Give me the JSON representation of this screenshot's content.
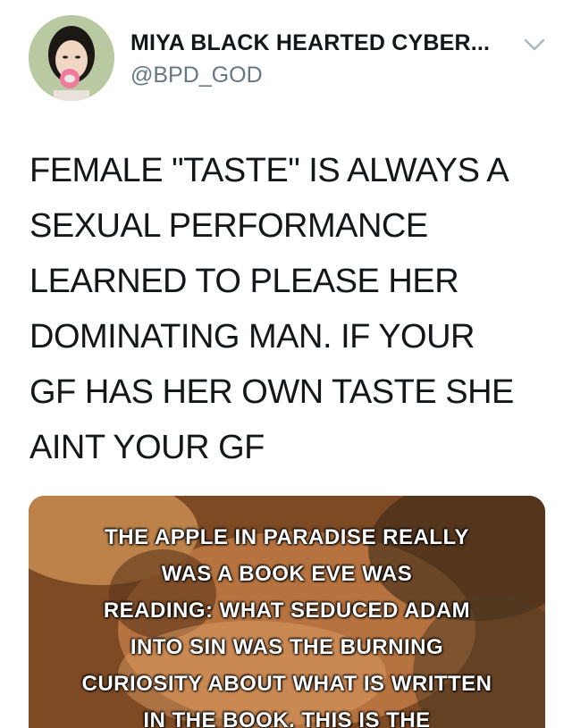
{
  "tweet": {
    "author_name": "MIYA BLACK HEARTED CYBER...",
    "author_handle": "@BPD_GOD",
    "text": "FEMALE \"TASTE\" IS ALWAYS A\nSEXUAL PERFORMANCE\nLEARNED TO PLEASE HER\nDOMINATING MAN. IF YOUR\nGF HAS HER OWN TASTE SHE\nAINT YOUR GF",
    "menu_icon": "chevron-down-icon"
  },
  "media": {
    "lines": [
      "THE APPLE IN  PARADISE REALLY",
      "WAS A BOOK EVE WAS",
      "READING: WHAT SEDUCED ADAM",
      "INTO SIN WAS THE BURNING",
      "CURIOSITY ABOUT WHAT IS WRITTEN",
      "IN THE BOOK. THIS IS THE"
    ]
  },
  "colors": {
    "text": "#14171a",
    "secondary": "#657786",
    "chevron": "#aab8c2"
  }
}
